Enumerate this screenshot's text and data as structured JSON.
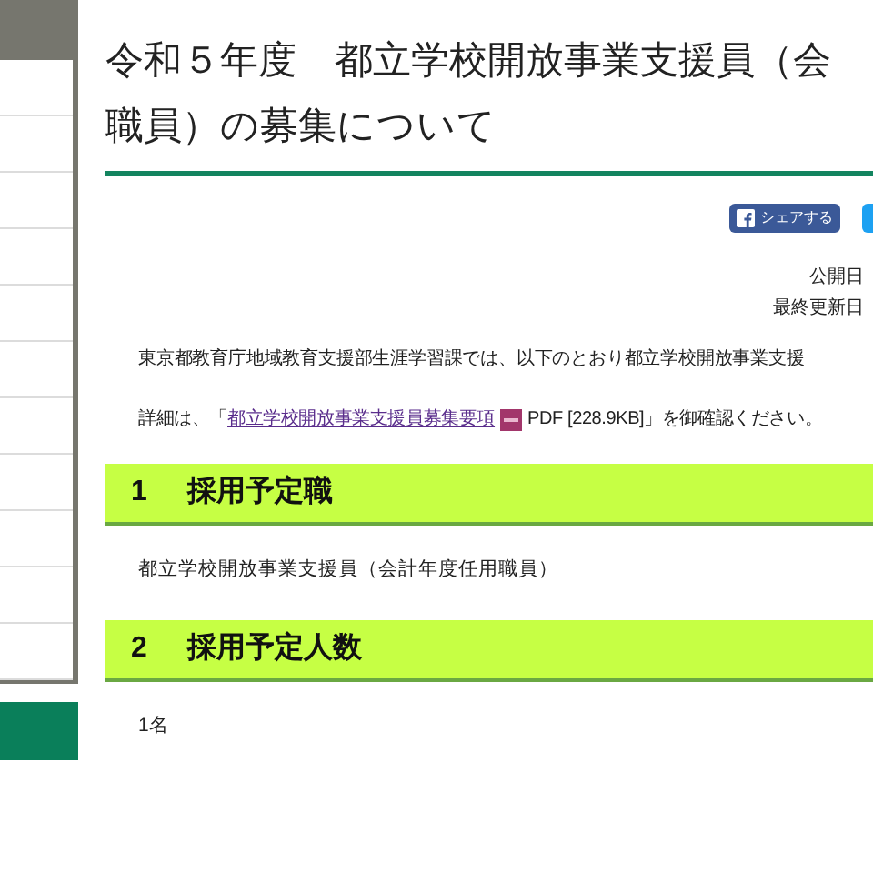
{
  "title_lines": [
    "令和５年度　都立学校開放事業支援員（会",
    "職員）の募集について"
  ],
  "share_button": {
    "label": "シェアする"
  },
  "dates": [
    "公開日",
    "最終更新日"
  ],
  "intro": "東京都教育庁地域教育支援部生涯学習課では、以下のとおり都立学校開放事業支援",
  "details": {
    "before": "詳細は、「",
    "link": "都立学校開放事業支援員募集要項",
    "file": "PDF [228.9KB]",
    "after": "」を御確認ください。"
  },
  "sections": [
    {
      "number": "1",
      "heading": "採用予定職",
      "body": "都立学校開放事業支援員（会計年度任用職員）"
    },
    {
      "number": "2",
      "heading": "採用予定人数",
      "body": "1名"
    }
  ]
}
